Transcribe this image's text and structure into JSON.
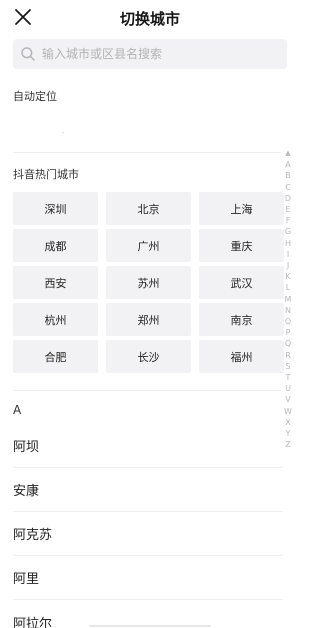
{
  "header": {
    "title": "切换城市",
    "close_icon": "close-icon"
  },
  "search": {
    "placeholder": "输入城市或区县名搜索",
    "value": "",
    "icon": "search-icon"
  },
  "auto_locate": {
    "label": "自动定位"
  },
  "hot_cities": {
    "title": "抖音热门城市",
    "items": [
      "深圳",
      "北京",
      "上海",
      "成都",
      "广州",
      "重庆",
      "西安",
      "苏州",
      "武汉",
      "杭州",
      "郑州",
      "南京",
      "合肥",
      "长沙",
      "福州"
    ]
  },
  "alphabet_index": {
    "top_icon": "up-arrow-icon",
    "letters": [
      "A",
      "B",
      "C",
      "D",
      "E",
      "F",
      "G",
      "H",
      "I",
      "J",
      "K",
      "L",
      "M",
      "N",
      "O",
      "P",
      "Q",
      "R",
      "S",
      "T",
      "U",
      "V",
      "W",
      "X",
      "Y",
      "Z"
    ]
  },
  "city_list": {
    "current_letter": "A",
    "cities": [
      "阿坝",
      "安康",
      "阿克苏",
      "阿里",
      "阿拉尔"
    ]
  },
  "colors": {
    "background": "#ffffff",
    "button_bg": "#f2f2f4",
    "placeholder": "#b3b3b6",
    "index_text": "#b8b8bc"
  }
}
